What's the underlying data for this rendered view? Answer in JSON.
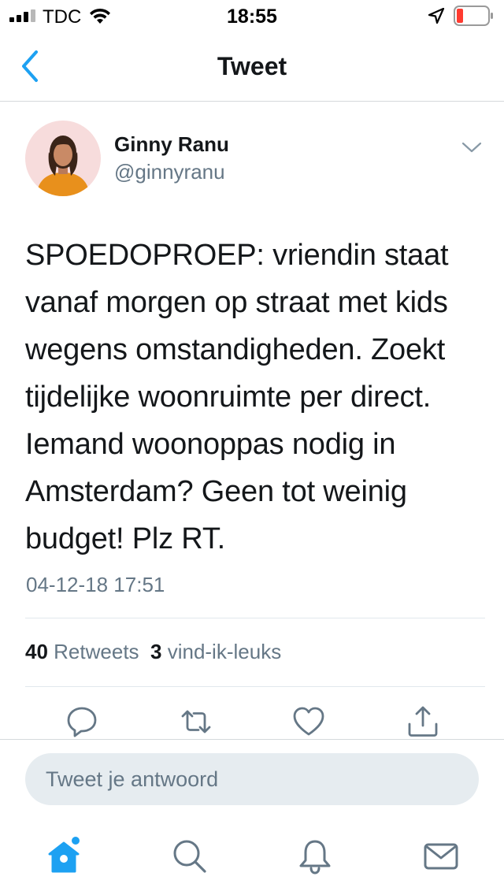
{
  "status_bar": {
    "carrier": "TDC",
    "time": "18:55",
    "icons": [
      "signal-icon",
      "wifi-icon",
      "location-arrow-icon",
      "battery-low-icon"
    ]
  },
  "nav": {
    "title": "Tweet",
    "back_icon": "chevron-left-icon"
  },
  "tweet": {
    "author_name": "Ginny Ranu",
    "author_handle": "@ginnyranu",
    "text": "SPOEDOPROEP: vriendin staat vanaf morgen op straat met kids wegens omstandigheden. Zoekt tijdelijke woonruimte per direct. Iemand woonoppas nodig in Amsterdam? Geen tot weinig budget! Plz RT.",
    "timestamp": "04-12-18 17:51",
    "retweet_count": "40",
    "retweet_label": "Retweets",
    "like_count": "3",
    "like_label": "vind-ik-leuks"
  },
  "actions": [
    "reply-icon",
    "retweet-icon",
    "like-icon",
    "share-icon"
  ],
  "reply": {
    "placeholder": "Tweet je antwoord"
  },
  "tab_bar": [
    "home-icon",
    "search-icon",
    "notifications-icon",
    "messages-icon"
  ],
  "colors": {
    "accent": "#1da1f2",
    "text": "#14171a",
    "secondary": "#657786",
    "icon_gray": "#657786",
    "battery_red": "#ff3b30",
    "divider": "#e1e8ed",
    "input_bg": "#e6ecf0"
  }
}
